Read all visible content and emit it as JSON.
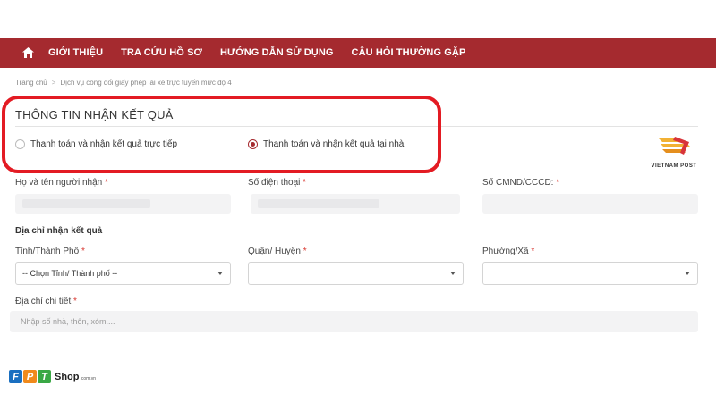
{
  "nav": {
    "items": [
      {
        "label": "GIỚI THIỆU"
      },
      {
        "label": "TRA CỨU HỒ SƠ"
      },
      {
        "label": "HƯỚNG DẪN SỬ DỤNG"
      },
      {
        "label": "CÂU HỎI THƯỜNG GẶP"
      }
    ]
  },
  "breadcrumb": {
    "home": "Trang chủ",
    "separator": ">",
    "current": "Dịch vụ công đổi giấy phép lái xe trực tuyến mức độ 4"
  },
  "result_section": {
    "title": "THÔNG TIN NHẬN KẾT QUẢ",
    "options": [
      {
        "label": "Thanh toán và nhận kết quả trực tiếp",
        "selected": false
      },
      {
        "label": "Thanh toán và nhận kết quả tại nhà",
        "selected": true
      }
    ]
  },
  "vietnam_post": {
    "label": "VIETNAM POST"
  },
  "recipient": {
    "name_label": "Họ và tên người nhận",
    "phone_label": "Số điện thoại",
    "id_label": "Số CMND/CCCD:",
    "required_mark": "*"
  },
  "address": {
    "heading": "Địa chỉ nhận kết quả",
    "province_label": "Tỉnh/Thành Phố",
    "province_value": "-- Chọn Tỉnh/ Thành phố --",
    "district_label": "Quận/ Huyện",
    "ward_label": "Phường/Xã",
    "detail_label": "Địa chỉ chi tiết",
    "detail_placeholder": "Nhập số nhà, thôn, xóm...."
  },
  "watermark": {
    "brand": "FPT",
    "letters": [
      "F",
      "P",
      "T"
    ],
    "shop": "Shop",
    "suffix": ".com.vn"
  },
  "colors": {
    "nav_bg": "#a52a2f",
    "highlight": "#e31b23",
    "fpt_blue": "#1a6fc0",
    "fpt_orange": "#f08a1c",
    "fpt_green": "#3aa845",
    "required": "#d9362f"
  },
  "icons": {
    "home": "home-icon",
    "caret": "chevron-down-icon",
    "vnpost": "vietnam-post-logo"
  }
}
